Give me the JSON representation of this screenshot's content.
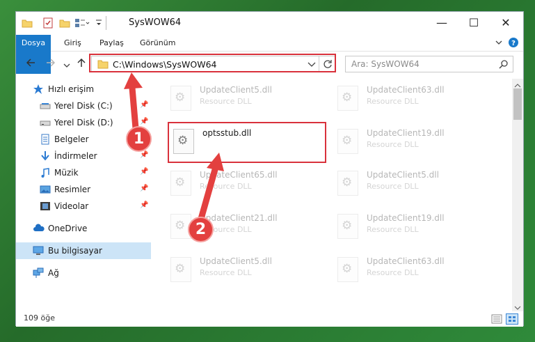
{
  "window": {
    "title": "SysWOW64",
    "controls": {
      "minimize": "—",
      "maximize": "☐",
      "close": "✕"
    }
  },
  "ribbon": {
    "tabs": [
      "Dosya",
      "Giriş",
      "Paylaş",
      "Görünüm"
    ],
    "expand_icon": "chevron-down-icon",
    "help_icon": "help-icon"
  },
  "navigation": {
    "address": "C:\\Windows\\SysWOW64",
    "search_placeholder": "Ara: SysWOW64"
  },
  "sidebar": {
    "items": [
      {
        "label": "Hızlı erişim",
        "icon": "star-icon",
        "pinned": false
      },
      {
        "label": "Yerel Disk (C:)",
        "icon": "drive-icon",
        "pinned": true
      },
      {
        "label": "Yerel Disk (D:)",
        "icon": "drive-icon",
        "pinned": true
      },
      {
        "label": "Belgeler",
        "icon": "documents-icon",
        "pinned": true
      },
      {
        "label": "İndirmeler",
        "icon": "download-icon",
        "pinned": true
      },
      {
        "label": "Müzik",
        "icon": "music-icon",
        "pinned": true
      },
      {
        "label": "Resimler",
        "icon": "pictures-icon",
        "pinned": true
      },
      {
        "label": "Videolar",
        "icon": "videos-icon",
        "pinned": true
      },
      {
        "label": "OneDrive",
        "icon": "cloud-icon",
        "pinned": false
      },
      {
        "label": "Bu bilgisayar",
        "icon": "computer-icon",
        "pinned": false,
        "selected": true
      },
      {
        "label": "Ağ",
        "icon": "network-icon",
        "pinned": false
      }
    ]
  },
  "files": {
    "left": [
      {
        "name": "UpdateClient5.dll",
        "desc": "Resource DLL"
      },
      {
        "name": "optsstub.dll",
        "desc": "",
        "highlighted": true
      },
      {
        "name": "UpdateClient65.dll",
        "desc": "Resource DLL"
      },
      {
        "name": "UpdateClient21.dll",
        "desc": "Resource DLL"
      },
      {
        "name": "UpdateClient5.dll",
        "desc": "Resource DLL"
      }
    ],
    "right": [
      {
        "name": "UpdateClient63.dll",
        "desc": "Resource DLL"
      },
      {
        "name": "UpdateClient19.dll",
        "desc": "Resource DLL"
      },
      {
        "name": "UpdateClient5.dll",
        "desc": "Resource DLL"
      },
      {
        "name": "UpdateClient19.dll",
        "desc": "Resource DLL"
      },
      {
        "name": "UpdateClient63.dll",
        "desc": "Resource DLL"
      }
    ]
  },
  "status": {
    "item_count": "109 öğe"
  },
  "annotations": {
    "step1": "1",
    "step2": "2",
    "color": "#d9313b"
  }
}
